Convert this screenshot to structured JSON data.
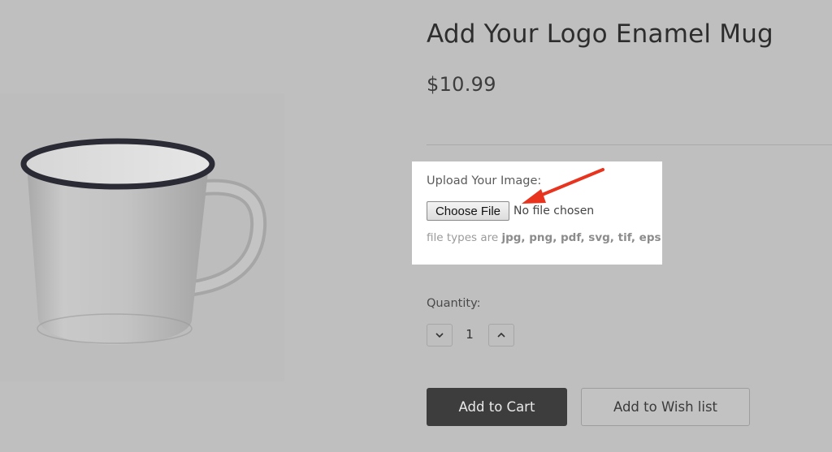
{
  "product": {
    "title": "Add Your Logo Enamel Mug",
    "price": "$10.99",
    "image_alt": "white enamel mug with black rim"
  },
  "upload": {
    "label": "Upload Your Image:",
    "button_label": "Choose File",
    "status": "No file chosen",
    "types_prefix": "file types are ",
    "types_list": "jpg, png, pdf, svg, tif, eps"
  },
  "quantity": {
    "label": "Quantity:",
    "value": "1",
    "decrease_icon": "chevron-down-icon",
    "increase_icon": "chevron-up-icon"
  },
  "actions": {
    "add_to_cart": "Add to Cart",
    "add_to_wishlist": "Add to Wish list"
  },
  "colors": {
    "page_background": "#bfbfbf",
    "primary_button": "#3d3d3d",
    "annotation_arrow": "#e8331f"
  }
}
